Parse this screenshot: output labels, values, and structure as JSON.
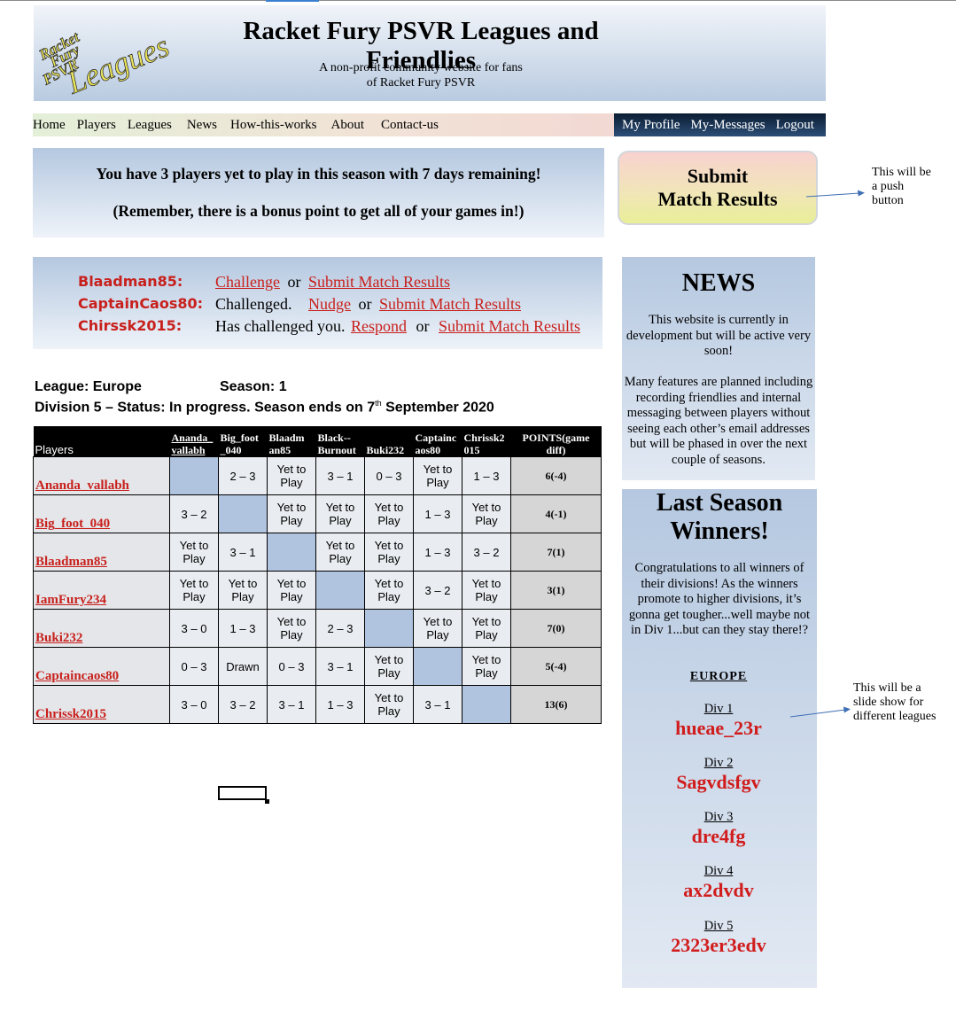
{
  "header": {
    "logo_words": [
      "Racket",
      "Fury",
      "PSVR",
      "Leagues"
    ],
    "title": "Racket Fury PSVR Leagues and Friendlies",
    "subtitle_line1": "A non-profit community website for fans",
    "subtitle_line2": "of Racket Fury PSVR"
  },
  "nav": {
    "items": [
      "Home",
      "Players",
      "Leagues",
      "News",
      "How-this-works",
      "About",
      "Contact-us"
    ],
    "user_items": [
      "My Profile",
      "My-Messages",
      "Logout"
    ]
  },
  "notice": {
    "line1": "You have 3 players yet to play in this season with 7 days remaining!",
    "line2": "(Remember, there is a bonus point to get all of your games in!)"
  },
  "submit_button": {
    "line1": "Submit",
    "line2": "Match Results"
  },
  "annotations": {
    "push_button": [
      "This will be",
      "a push",
      "button"
    ],
    "slideshow": [
      "This will be a",
      "slide show for",
      "different leagues"
    ]
  },
  "challenges": [
    {
      "name": "Blaadman85:",
      "status": "",
      "link1": "Challenge",
      "sep": "or",
      "link2": "Submit Match Results"
    },
    {
      "name": "CaptainCaos80:",
      "status": "Challenged.",
      "link1": "Nudge",
      "sep": "or",
      "link2": "Submit Match Results"
    },
    {
      "name": "Chirssk2015:",
      "status": "Has challenged you.",
      "link1": "Respond",
      "sep": "or",
      "link2": "Submit Match Results"
    }
  ],
  "league": {
    "league_label": "League: Europe",
    "season_label": "Season: 1",
    "status_prefix": "Division 5 – Status: In progress.  Season ends on 7",
    "status_sup": "th",
    "status_suffix": " September 2020"
  },
  "table": {
    "players_header": "Players",
    "columns": [
      "Ananda_ vallabh",
      "Big_foot _040",
      "Blaadm an85",
      "Black-- Burnout",
      "Buki232",
      "Captainc aos80",
      "Chrissk2 015"
    ],
    "points_header": "POINTS(game diff)",
    "rows": [
      {
        "player": "Ananda_vallabh",
        "cells": [
          "",
          "2 – 3",
          "Yet to Play",
          "3 – 1",
          "0 – 3",
          "Yet to Play",
          "1 – 3"
        ],
        "points": "6(-4)"
      },
      {
        "player": "Big_foot_040",
        "cells": [
          "3 – 2",
          "",
          "Yet to Play",
          "Yet to Play",
          "Yet to Play",
          "1 – 3",
          "Yet to Play"
        ],
        "points": "4(-1)"
      },
      {
        "player": "Blaadman85",
        "cells": [
          "Yet to Play",
          "3 – 1",
          "",
          "Yet to Play",
          "Yet to Play",
          "1 – 3",
          "3 – 2"
        ],
        "points": "7(1)"
      },
      {
        "player": "IamFury234",
        "cells": [
          "Yet to Play",
          "Yet to Play",
          "Yet to Play",
          "",
          "Yet to Play",
          "3 – 2",
          "Yet to Play"
        ],
        "points": "3(1)"
      },
      {
        "player": "Buki232",
        "cells": [
          "3 – 0",
          "1 – 3",
          "Yet to Play",
          "2 – 3",
          "",
          "Yet to Play",
          "Yet to Play"
        ],
        "points": "7(0)"
      },
      {
        "player": "Captaincaos80",
        "cells": [
          "0 – 3",
          "Drawn",
          "0 – 3",
          "3 – 1",
          "Yet to Play",
          "",
          "Yet to Play"
        ],
        "points": "5(-4)"
      },
      {
        "player": "Chrissk2015",
        "cells": [
          "3 – 0",
          "3 – 2",
          "3 – 1",
          "1 – 3",
          "Yet to Play",
          "3 – 1",
          ""
        ],
        "points": "13(6)"
      }
    ]
  },
  "news": {
    "title": "NEWS",
    "paragraph1": "This website is currently in development but will be active very soon!",
    "paragraph2": "Many features are planned including recording friendlies and internal messaging between players without seeing each other’s email addresses but will be phased in over the next couple of seasons."
  },
  "winners": {
    "title_line1": "Last Season",
    "title_line2": "Winners!",
    "text": "Congratulations to all winners of their divisions! As the winners promote to higher divisions, it’s gonna get tougher...well maybe not in Div 1...but can they stay there!?",
    "region": "EUROPE",
    "divisions": [
      {
        "label": "Div 1",
        "winner": "hueae_23r"
      },
      {
        "label": "Div 2",
        "winner": "Sagvdsfgv"
      },
      {
        "label": "Div 3",
        "winner": "dre4fg"
      },
      {
        "label": "Div 4",
        "winner": "ax2dvdv"
      },
      {
        "label": "Div 5",
        "winner": "2323er3edv"
      }
    ]
  },
  "colors": {
    "accent_red": "#c8201c",
    "panel_blue": "#b5c8e0",
    "nav_dark": "#0b1d33"
  }
}
